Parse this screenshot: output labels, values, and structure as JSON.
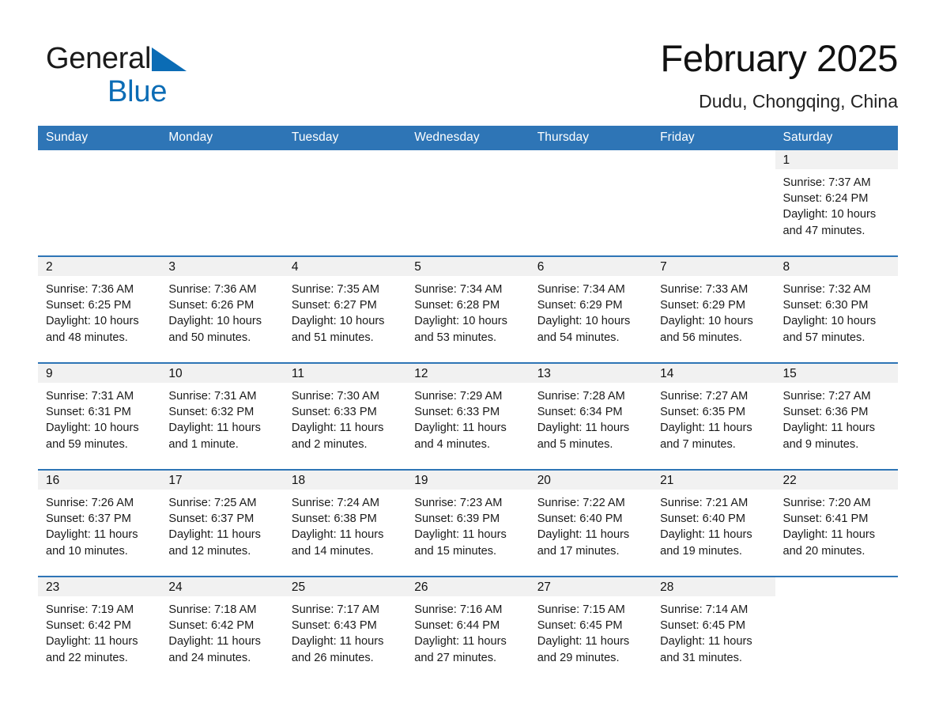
{
  "brand": {
    "name_part1": "General",
    "name_part2": "Blue",
    "triangle_icon": "triangle-icon",
    "accent_color": "#0b6cb5"
  },
  "header": {
    "title": "February 2025",
    "location": "Dudu, Chongqing, China"
  },
  "theme": {
    "header_blue": "#2e75b6",
    "daynum_strip_gray": "#f1f1f1",
    "text": "#1a1a1a"
  },
  "calendar": {
    "weekday_headers": [
      "Sunday",
      "Monday",
      "Tuesday",
      "Wednesday",
      "Thursday",
      "Friday",
      "Saturday"
    ],
    "labels": {
      "sunrise": "Sunrise:",
      "sunset": "Sunset:",
      "daylight": "Daylight:"
    },
    "weeks": [
      [
        {
          "day": "",
          "blank": true
        },
        {
          "day": "",
          "blank": true
        },
        {
          "day": "",
          "blank": true
        },
        {
          "day": "",
          "blank": true
        },
        {
          "day": "",
          "blank": true
        },
        {
          "day": "",
          "blank": true
        },
        {
          "day": "1",
          "sunrise": "Sunrise: 7:37 AM",
          "sunset": "Sunset: 6:24 PM",
          "daylight_l1": "Daylight: 10 hours",
          "daylight_l2": "and 47 minutes."
        }
      ],
      [
        {
          "day": "2",
          "sunrise": "Sunrise: 7:36 AM",
          "sunset": "Sunset: 6:25 PM",
          "daylight_l1": "Daylight: 10 hours",
          "daylight_l2": "and 48 minutes."
        },
        {
          "day": "3",
          "sunrise": "Sunrise: 7:36 AM",
          "sunset": "Sunset: 6:26 PM",
          "daylight_l1": "Daylight: 10 hours",
          "daylight_l2": "and 50 minutes."
        },
        {
          "day": "4",
          "sunrise": "Sunrise: 7:35 AM",
          "sunset": "Sunset: 6:27 PM",
          "daylight_l1": "Daylight: 10 hours",
          "daylight_l2": "and 51 minutes."
        },
        {
          "day": "5",
          "sunrise": "Sunrise: 7:34 AM",
          "sunset": "Sunset: 6:28 PM",
          "daylight_l1": "Daylight: 10 hours",
          "daylight_l2": "and 53 minutes."
        },
        {
          "day": "6",
          "sunrise": "Sunrise: 7:34 AM",
          "sunset": "Sunset: 6:29 PM",
          "daylight_l1": "Daylight: 10 hours",
          "daylight_l2": "and 54 minutes."
        },
        {
          "day": "7",
          "sunrise": "Sunrise: 7:33 AM",
          "sunset": "Sunset: 6:29 PM",
          "daylight_l1": "Daylight: 10 hours",
          "daylight_l2": "and 56 minutes."
        },
        {
          "day": "8",
          "sunrise": "Sunrise: 7:32 AM",
          "sunset": "Sunset: 6:30 PM",
          "daylight_l1": "Daylight: 10 hours",
          "daylight_l2": "and 57 minutes."
        }
      ],
      [
        {
          "day": "9",
          "sunrise": "Sunrise: 7:31 AM",
          "sunset": "Sunset: 6:31 PM",
          "daylight_l1": "Daylight: 10 hours",
          "daylight_l2": "and 59 minutes."
        },
        {
          "day": "10",
          "sunrise": "Sunrise: 7:31 AM",
          "sunset": "Sunset: 6:32 PM",
          "daylight_l1": "Daylight: 11 hours",
          "daylight_l2": "and 1 minute."
        },
        {
          "day": "11",
          "sunrise": "Sunrise: 7:30 AM",
          "sunset": "Sunset: 6:33 PM",
          "daylight_l1": "Daylight: 11 hours",
          "daylight_l2": "and 2 minutes."
        },
        {
          "day": "12",
          "sunrise": "Sunrise: 7:29 AM",
          "sunset": "Sunset: 6:33 PM",
          "daylight_l1": "Daylight: 11 hours",
          "daylight_l2": "and 4 minutes."
        },
        {
          "day": "13",
          "sunrise": "Sunrise: 7:28 AM",
          "sunset": "Sunset: 6:34 PM",
          "daylight_l1": "Daylight: 11 hours",
          "daylight_l2": "and 5 minutes."
        },
        {
          "day": "14",
          "sunrise": "Sunrise: 7:27 AM",
          "sunset": "Sunset: 6:35 PM",
          "daylight_l1": "Daylight: 11 hours",
          "daylight_l2": "and 7 minutes."
        },
        {
          "day": "15",
          "sunrise": "Sunrise: 7:27 AM",
          "sunset": "Sunset: 6:36 PM",
          "daylight_l1": "Daylight: 11 hours",
          "daylight_l2": "and 9 minutes."
        }
      ],
      [
        {
          "day": "16",
          "sunrise": "Sunrise: 7:26 AM",
          "sunset": "Sunset: 6:37 PM",
          "daylight_l1": "Daylight: 11 hours",
          "daylight_l2": "and 10 minutes."
        },
        {
          "day": "17",
          "sunrise": "Sunrise: 7:25 AM",
          "sunset": "Sunset: 6:37 PM",
          "daylight_l1": "Daylight: 11 hours",
          "daylight_l2": "and 12 minutes."
        },
        {
          "day": "18",
          "sunrise": "Sunrise: 7:24 AM",
          "sunset": "Sunset: 6:38 PM",
          "daylight_l1": "Daylight: 11 hours",
          "daylight_l2": "and 14 minutes."
        },
        {
          "day": "19",
          "sunrise": "Sunrise: 7:23 AM",
          "sunset": "Sunset: 6:39 PM",
          "daylight_l1": "Daylight: 11 hours",
          "daylight_l2": "and 15 minutes."
        },
        {
          "day": "20",
          "sunrise": "Sunrise: 7:22 AM",
          "sunset": "Sunset: 6:40 PM",
          "daylight_l1": "Daylight: 11 hours",
          "daylight_l2": "and 17 minutes."
        },
        {
          "day": "21",
          "sunrise": "Sunrise: 7:21 AM",
          "sunset": "Sunset: 6:40 PM",
          "daylight_l1": "Daylight: 11 hours",
          "daylight_l2": "and 19 minutes."
        },
        {
          "day": "22",
          "sunrise": "Sunrise: 7:20 AM",
          "sunset": "Sunset: 6:41 PM",
          "daylight_l1": "Daylight: 11 hours",
          "daylight_l2": "and 20 minutes."
        }
      ],
      [
        {
          "day": "23",
          "sunrise": "Sunrise: 7:19 AM",
          "sunset": "Sunset: 6:42 PM",
          "daylight_l1": "Daylight: 11 hours",
          "daylight_l2": "and 22 minutes."
        },
        {
          "day": "24",
          "sunrise": "Sunrise: 7:18 AM",
          "sunset": "Sunset: 6:42 PM",
          "daylight_l1": "Daylight: 11 hours",
          "daylight_l2": "and 24 minutes."
        },
        {
          "day": "25",
          "sunrise": "Sunrise: 7:17 AM",
          "sunset": "Sunset: 6:43 PM",
          "daylight_l1": "Daylight: 11 hours",
          "daylight_l2": "and 26 minutes."
        },
        {
          "day": "26",
          "sunrise": "Sunrise: 7:16 AM",
          "sunset": "Sunset: 6:44 PM",
          "daylight_l1": "Daylight: 11 hours",
          "daylight_l2": "and 27 minutes."
        },
        {
          "day": "27",
          "sunrise": "Sunrise: 7:15 AM",
          "sunset": "Sunset: 6:45 PM",
          "daylight_l1": "Daylight: 11 hours",
          "daylight_l2": "and 29 minutes."
        },
        {
          "day": "28",
          "sunrise": "Sunrise: 7:14 AM",
          "sunset": "Sunset: 6:45 PM",
          "daylight_l1": "Daylight: 11 hours",
          "daylight_l2": "and 31 minutes."
        },
        {
          "day": "",
          "blank": true
        }
      ]
    ]
  }
}
